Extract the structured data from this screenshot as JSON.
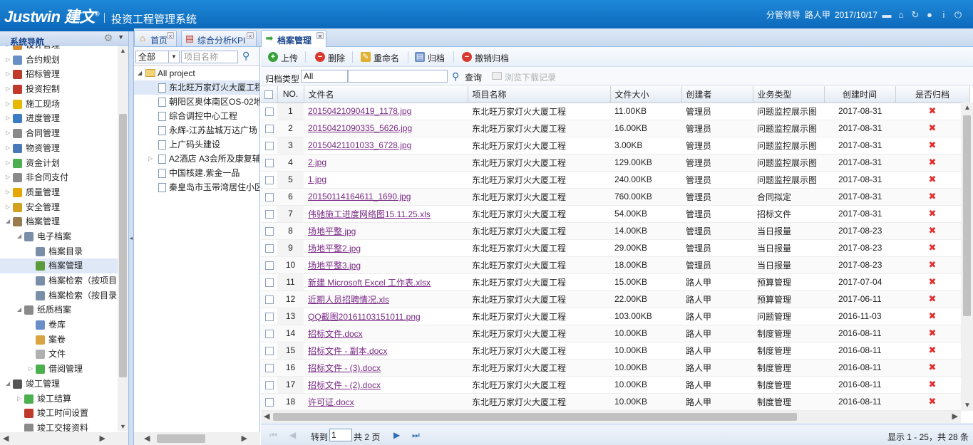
{
  "header": {
    "logo": "Justwin",
    "logo_cn": "建文",
    "system_name": "投资工程管理系统",
    "user_role": "分管领导",
    "user_name": "路人甲",
    "date": "2017/10/17"
  },
  "nav": {
    "title": "系统导航",
    "items": [
      {
        "label": "设计管理",
        "level": 0,
        "arrow": "▷",
        "color": "#d98b2b"
      },
      {
        "label": "合约规划",
        "level": 0,
        "arrow": "▷",
        "color": "#6a8fc7"
      },
      {
        "label": "招标管理",
        "level": 0,
        "arrow": "▷",
        "color": "#c0392b"
      },
      {
        "label": "投资控制",
        "level": 0,
        "arrow": "▷",
        "color": "#c0392b"
      },
      {
        "label": "施工现场",
        "level": 0,
        "arrow": "▷",
        "color": "#e6b800"
      },
      {
        "label": "进度管理",
        "level": 0,
        "arrow": "▷",
        "color": "#3b7dc4"
      },
      {
        "label": "合同管理",
        "level": 0,
        "arrow": "▷",
        "color": "#8a8a8a"
      },
      {
        "label": "物资管理",
        "level": 0,
        "arrow": "▷",
        "color": "#4a78b8"
      },
      {
        "label": "资金计划",
        "level": 0,
        "arrow": "▷",
        "color": "#4caf50"
      },
      {
        "label": "非合同支付",
        "level": 0,
        "arrow": "▷",
        "color": "#8a8a8a"
      },
      {
        "label": "质量管理",
        "level": 0,
        "arrow": "▷",
        "color": "#e6a800"
      },
      {
        "label": "安全管理",
        "level": 0,
        "arrow": "▷",
        "color": "#d4a020"
      },
      {
        "label": "档案管理",
        "level": 0,
        "arrow": "◢",
        "color": "#9a7b4f"
      },
      {
        "label": "电子档案",
        "level": 1,
        "arrow": "◢",
        "color": "#7a8ea8"
      },
      {
        "label": "档案目录",
        "level": 2,
        "arrow": "",
        "color": "#7a8ea8"
      },
      {
        "label": "档案管理",
        "level": 2,
        "arrow": "",
        "color": "#5a9a3a",
        "selected": true
      },
      {
        "label": "档案检索（按项目",
        "level": 2,
        "arrow": "",
        "color": "#7a8ea8"
      },
      {
        "label": "档案检索（按目录",
        "level": 2,
        "arrow": "",
        "color": "#7a8ea8"
      },
      {
        "label": "纸质档案",
        "level": 1,
        "arrow": "◢",
        "color": "#8a8a8a"
      },
      {
        "label": "卷库",
        "level": 2,
        "arrow": "",
        "color": "#6a8fc7"
      },
      {
        "label": "案卷",
        "level": 2,
        "arrow": "",
        "color": "#d9a441"
      },
      {
        "label": "文件",
        "level": 2,
        "arrow": "",
        "color": "#b0b0b0"
      },
      {
        "label": "借阅管理",
        "level": 2,
        "arrow": "▷",
        "color": "#4caf50"
      },
      {
        "label": "竣工管理",
        "level": 0,
        "arrow": "◢",
        "color": "#555555"
      },
      {
        "label": "竣工结算",
        "level": 1,
        "arrow": "▷",
        "color": "#4caf50"
      },
      {
        "label": "竣工时间设置",
        "level": 1,
        "arrow": "",
        "color": "#c0392b"
      },
      {
        "label": "竣工交接资料",
        "level": 1,
        "arrow": "",
        "color": "#8a8a8a"
      }
    ]
  },
  "tabs": [
    {
      "label": "首页",
      "icon": "⌂"
    },
    {
      "label": "综合分析KPI",
      "icon": "▤"
    },
    {
      "label": "档案管理",
      "icon": "➡",
      "active": true
    }
  ],
  "project_panel": {
    "filter_value": "全部",
    "search_placeholder": "项目名称",
    "root": "All project",
    "projects": [
      {
        "label": "东北旺万家灯火大厦工程",
        "selected": true
      },
      {
        "label": "朝阳区奥体南区OS-02地块"
      },
      {
        "label": "综合调控中心工程"
      },
      {
        "label": "永辉-江苏盐城万达广场"
      },
      {
        "label": "上广码头建设"
      },
      {
        "label": "A2酒店 A3会所及康复辅",
        "expandable": true
      },
      {
        "label": "中国核建.紫金一品"
      },
      {
        "label": "秦皇岛市玉带湾居住小区"
      }
    ]
  },
  "toolbar": {
    "upload": "上传",
    "delete": "删除",
    "rename": "重命名",
    "archive": "归档",
    "unarchive": "撤销归档"
  },
  "filter": {
    "type_label": "归档类型",
    "type_value": "All",
    "query_label": "查询",
    "download_log_label": "浏览下载记录"
  },
  "grid": {
    "columns": [
      "NO.",
      "文件名",
      "项目名称",
      "文件大小",
      "创建者",
      "业务类型",
      "创建时间",
      "是否归档"
    ],
    "rows": [
      {
        "no": "1",
        "file": "20150421090419_1178.jpg",
        "project": "东北旺万家灯火大厦工程",
        "size": "11.00KB",
        "creator": "管理员",
        "type": "问题监控展示图",
        "date": "2017-08-31",
        "archived": "✖"
      },
      {
        "no": "2",
        "file": "20150421090335_5626.jpg",
        "project": "东北旺万家灯火大厦工程",
        "size": "16.00KB",
        "creator": "管理员",
        "type": "问题监控展示图",
        "date": "2017-08-31",
        "archived": "✖"
      },
      {
        "no": "3",
        "file": "20150421101033_6728.jpg",
        "project": "东北旺万家灯火大厦工程",
        "size": "3.00KB",
        "creator": "管理员",
        "type": "问题监控展示图",
        "date": "2017-08-31",
        "archived": "✖"
      },
      {
        "no": "4",
        "file": "2.jpg",
        "project": "东北旺万家灯火大厦工程",
        "size": "129.00KB",
        "creator": "管理员",
        "type": "问题监控展示图",
        "date": "2017-08-31",
        "archived": "✖"
      },
      {
        "no": "5",
        "file": "1.jpg",
        "project": "东北旺万家灯火大厦工程",
        "size": "240.00KB",
        "creator": "管理员",
        "type": "问题监控展示图",
        "date": "2017-08-31",
        "archived": "✖"
      },
      {
        "no": "6",
        "file": "20150114164611_1690.jpg",
        "project": "东北旺万家灯火大厦工程",
        "size": "760.00KB",
        "creator": "管理员",
        "type": "合同拟定",
        "date": "2017-08-31",
        "archived": "✖"
      },
      {
        "no": "7",
        "file": "伟驰施工进度网络图15.11.25.xls",
        "project": "东北旺万家灯火大厦工程",
        "size": "54.00KB",
        "creator": "管理员",
        "type": "招标文件",
        "date": "2017-08-31",
        "archived": "✖"
      },
      {
        "no": "8",
        "file": "场地平整.jpg",
        "project": "东北旺万家灯火大厦工程",
        "size": "14.00KB",
        "creator": "管理员",
        "type": "当日报量",
        "date": "2017-08-23",
        "archived": "✖"
      },
      {
        "no": "9",
        "file": "场地平整2.jpg",
        "project": "东北旺万家灯火大厦工程",
        "size": "29.00KB",
        "creator": "管理员",
        "type": "当日报量",
        "date": "2017-08-23",
        "archived": "✖"
      },
      {
        "no": "10",
        "file": "场地平整3.jpg",
        "project": "东北旺万家灯火大厦工程",
        "size": "18.00KB",
        "creator": "管理员",
        "type": "当日报量",
        "date": "2017-08-23",
        "archived": "✖"
      },
      {
        "no": "11",
        "file": "新建 Microsoft Excel 工作表.xlsx",
        "project": "东北旺万家灯火大厦工程",
        "size": "15.00KB",
        "creator": "路人甲",
        "type": "预算管理",
        "date": "2017-07-04",
        "archived": "✖"
      },
      {
        "no": "12",
        "file": "近期人员招聘情况.xls",
        "project": "东北旺万家灯火大厦工程",
        "size": "22.00KB",
        "creator": "路人甲",
        "type": "预算管理",
        "date": "2017-06-11",
        "archived": "✖"
      },
      {
        "no": "13",
        "file": "QQ截图20161103151011.png",
        "project": "东北旺万家灯火大厦工程",
        "size": "103.00KB",
        "creator": "路人甲",
        "type": "问题管理",
        "date": "2016-11-03",
        "archived": "✖"
      },
      {
        "no": "14",
        "file": "招标文件.docx",
        "project": "东北旺万家灯火大厦工程",
        "size": "10.00KB",
        "creator": "路人甲",
        "type": "制度管理",
        "date": "2016-08-11",
        "archived": "✖"
      },
      {
        "no": "15",
        "file": "招标文件 - 副本.docx",
        "project": "东北旺万家灯火大厦工程",
        "size": "10.00KB",
        "creator": "路人甲",
        "type": "制度管理",
        "date": "2016-08-11",
        "archived": "✖"
      },
      {
        "no": "16",
        "file": "招标文件 - (3).docx",
        "project": "东北旺万家灯火大厦工程",
        "size": "10.00KB",
        "creator": "路人甲",
        "type": "制度管理",
        "date": "2016-08-11",
        "archived": "✖"
      },
      {
        "no": "17",
        "file": "招标文件 - (2).docx",
        "project": "东北旺万家灯火大厦工程",
        "size": "10.00KB",
        "creator": "路人甲",
        "type": "制度管理",
        "date": "2016-08-11",
        "archived": "✖"
      },
      {
        "no": "18",
        "file": "许可证.docx",
        "project": "东北旺万家灯火大厦工程",
        "size": "10.00KB",
        "creator": "路人甲",
        "type": "制度管理",
        "date": "2016-08-11",
        "archived": "✖"
      }
    ]
  },
  "pager": {
    "goto_label": "转到",
    "page": "1",
    "total_label": "共 2 页",
    "summary": "显示 1 - 25，共 28 条"
  }
}
